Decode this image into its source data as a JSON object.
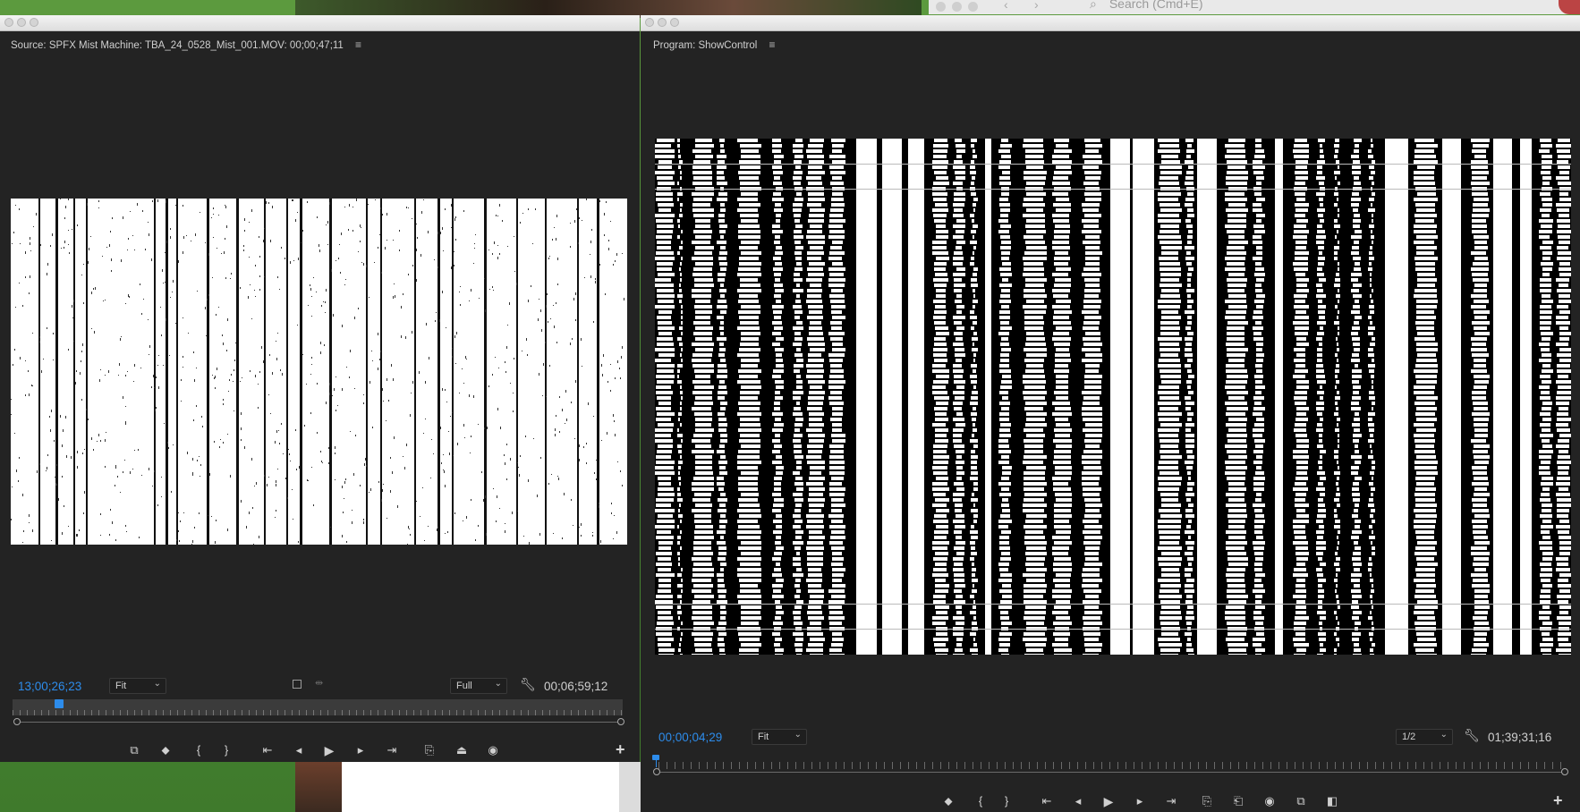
{
  "desktop": {
    "browser_search_placeholder": "Search (Cmd+E)"
  },
  "source_monitor": {
    "title": "Source: SPFX Mist Machine: TBA_24_0528_Mist_001.MOV: 00;00;47;11",
    "menu_icon": "hamburger-icon",
    "current_timecode": "13;00;26;23",
    "zoom": "Fit",
    "resolution": "Full",
    "duration_timecode": "00;06;59;12",
    "controls": [
      "export-frame-overlay-icon",
      "marker-icon",
      "mark-in-icon",
      "mark-out-icon",
      "go-to-in-icon",
      "step-back-icon",
      "play-icon",
      "step-forward-icon",
      "go-to-out-icon",
      "insert-icon",
      "overwrite-icon",
      "camera-icon"
    ],
    "control_glyphs": {
      "overlay": "⧉",
      "marker": "⬥",
      "mark_in": "{",
      "mark_out": "}",
      "go_in": "⇤",
      "step_back": "◂",
      "play": "▶",
      "step_fwd": "▸",
      "go_out": "⇥",
      "insert": "⎘",
      "overwrite": "⏏",
      "camera": "◉",
      "add": "+"
    },
    "playhead_fraction": 0.08
  },
  "program_monitor": {
    "title": "Program: ShowControl",
    "menu_icon": "hamburger-icon",
    "current_timecode": "00;00;04;29",
    "zoom": "Fit",
    "resolution": "1/2",
    "duration_timecode": "01;39;31;16",
    "control_glyphs": {
      "marker": "⬥",
      "mark_in": "{",
      "mark_out": "}",
      "go_in": "⇤",
      "step_back": "◂",
      "play": "▶",
      "step_fwd": "▸",
      "go_out": "⇥",
      "lift": "⎘",
      "extract": "⎗",
      "camera": "◉",
      "overlay": "⧉",
      "compare": "◧",
      "add": "+"
    },
    "playhead_fraction": 0.0
  },
  "colors": {
    "panel_bg": "#232323",
    "timecode_accent": "#2d8ceb"
  }
}
